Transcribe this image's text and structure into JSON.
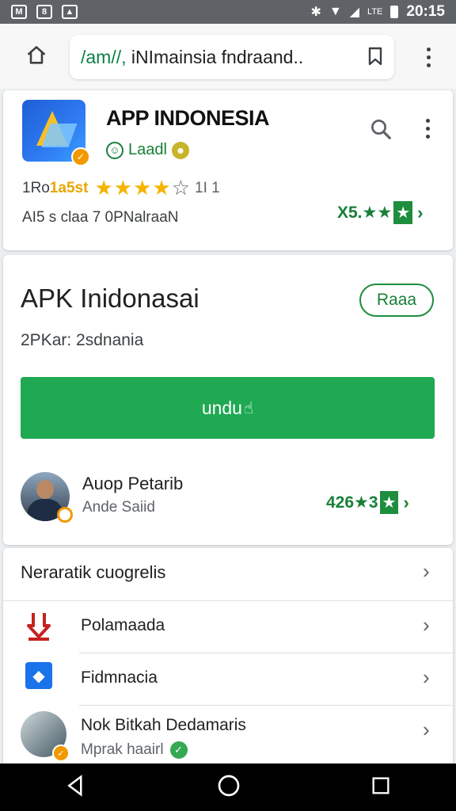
{
  "status_bar": {
    "left_icons": [
      "gmail-icon",
      "sync-icon",
      "photos-icon"
    ],
    "data_label": "LTE",
    "time": "20:15"
  },
  "browser": {
    "url_scheme": "/am//,",
    "url_text": " iNImainsia fndraand.."
  },
  "app_header": {
    "title": "APP INDONESIA",
    "developer": "Laadl",
    "rating_prefix": "1Ro",
    "rating_highlight": "1a5st",
    "stars": "★★★★",
    "star_empty": "☆",
    "rating_count": "1I 1",
    "info": "AI5 s claa 7 0PNalraaN",
    "score_text": "X5.",
    "score_stars": "★★",
    "score_box": "★"
  },
  "main_card": {
    "title": "APK Inidonasai",
    "outline_button": "Raaa",
    "subtitle": "2PKar: 2sdnania",
    "install_button": "undu",
    "publisher_name": "Auop Petarib",
    "publisher_sub": "Ande Saiid",
    "publisher_score": "426★3",
    "publisher_box": "★"
  },
  "list_section": {
    "header": "Neraratik cuogrelis",
    "items": [
      {
        "label": "Polamaada"
      },
      {
        "label": "Fidmnacia"
      },
      {
        "label": "Nok Bitkah Dedamaris",
        "sub": "Mprak haairl"
      }
    ]
  },
  "colors": {
    "accent_green": "#1ea952",
    "star_gold": "#f4b400",
    "status_bar": "#5f6368"
  }
}
